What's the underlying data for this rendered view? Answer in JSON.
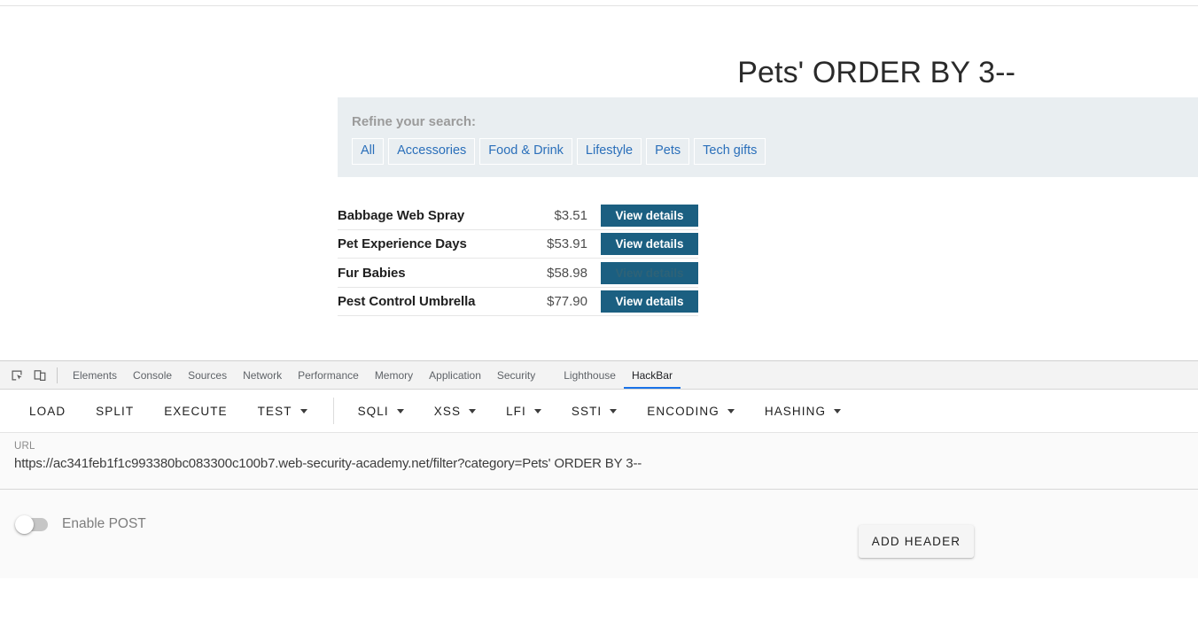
{
  "page": {
    "title": "Pets' ORDER BY 3--",
    "filter": {
      "label": "Refine your search:",
      "chips": [
        {
          "label": "All"
        },
        {
          "label": "Accessories"
        },
        {
          "label": "Food & Drink"
        },
        {
          "label": "Lifestyle"
        },
        {
          "label": "Pets"
        },
        {
          "label": "Tech gifts"
        }
      ]
    },
    "products": [
      {
        "name": "Babbage Web Spray",
        "price": "$3.51",
        "button": "View details",
        "hovered": false
      },
      {
        "name": "Pet Experience Days",
        "price": "$53.91",
        "button": "View details",
        "hovered": false
      },
      {
        "name": "Fur Babies",
        "price": "$58.98",
        "button": "View details",
        "hovered": true
      },
      {
        "name": "Pest Control Umbrella",
        "price": "$77.90",
        "button": "View details",
        "hovered": false
      }
    ]
  },
  "devtools": {
    "icons": [
      {
        "name": "inspect-element-icon"
      },
      {
        "name": "device-toolbar-icon"
      }
    ],
    "tabs": [
      {
        "label": "Elements",
        "active": false
      },
      {
        "label": "Console",
        "active": false
      },
      {
        "label": "Sources",
        "active": false
      },
      {
        "label": "Network",
        "active": false
      },
      {
        "label": "Performance",
        "active": false
      },
      {
        "label": "Memory",
        "active": false
      },
      {
        "label": "Application",
        "active": false
      },
      {
        "label": "Security",
        "active": false
      },
      {
        "label": "Lighthouse",
        "active": false
      },
      {
        "label": "HackBar",
        "active": true
      }
    ]
  },
  "hackbar": {
    "toolbar": [
      {
        "label": "LOAD",
        "caret": false
      },
      {
        "label": "SPLIT",
        "caret": false
      },
      {
        "label": "EXECUTE",
        "caret": false
      },
      {
        "label": "TEST",
        "caret": true
      },
      {
        "label": "SQLI",
        "caret": true
      },
      {
        "label": "XSS",
        "caret": true
      },
      {
        "label": "LFI",
        "caret": true
      },
      {
        "label": "SSTI",
        "caret": true
      },
      {
        "label": "ENCODING",
        "caret": true
      },
      {
        "label": "HASHING",
        "caret": true
      }
    ],
    "url": {
      "label": "URL",
      "value": "https://ac341feb1f1c993380bc083300c100b7.web-security-academy.net/filter?category=Pets' ORDER BY 3--",
      "placeholder": "URL"
    },
    "enable_post": {
      "label": "Enable POST",
      "checked": false
    },
    "add_header": {
      "label": "ADD HEADER"
    }
  },
  "colors": {
    "accent_blue": "#1a73e8",
    "button_teal": "#1b5f81",
    "link_blue": "#2a6fba",
    "filter_bg": "#e9eef1"
  }
}
